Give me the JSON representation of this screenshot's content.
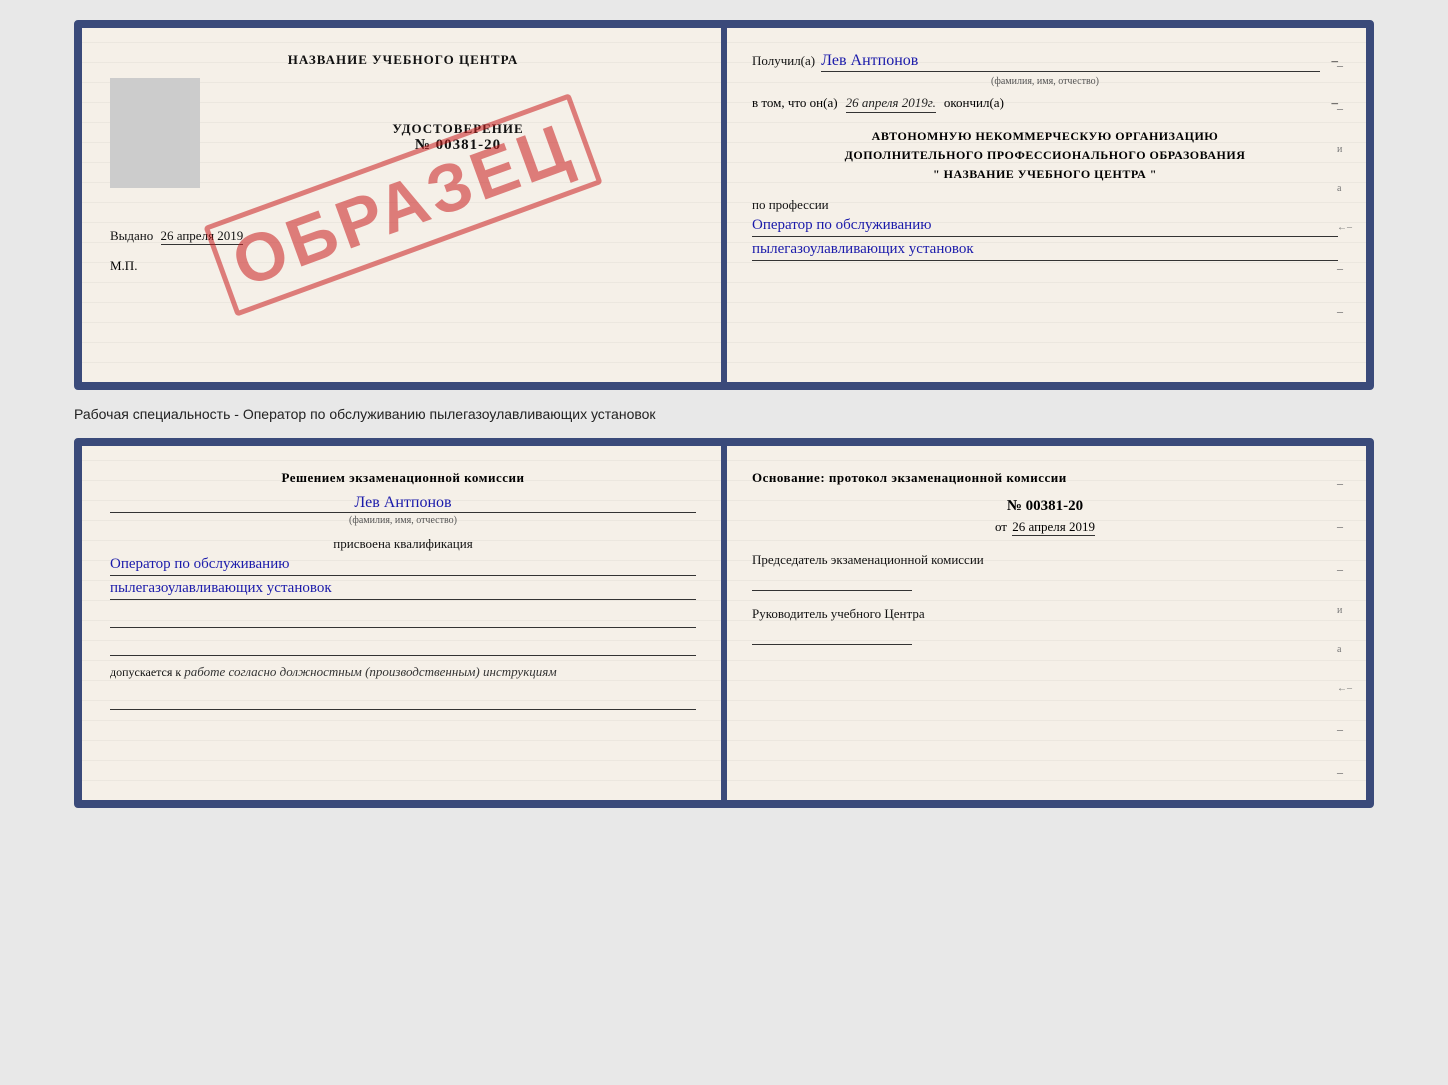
{
  "cert": {
    "left": {
      "training_center": "НАЗВАНИЕ УЧЕБНОГО ЦЕНТРА",
      "udostoverenie_label": "УДОСТОВЕРЕНИЕ",
      "cert_number": "№ 00381-20",
      "issued_label": "Выдано",
      "issued_date": "26 апреля 2019",
      "mp_label": "М.П.",
      "obrazec": "ОБРАЗЕЦ"
    },
    "right": {
      "received_label": "Получил(а)",
      "person_name": "Лев Антпонов",
      "fio_label": "(фамилия, имя, отчество)",
      "completed_prefix": "в том, что он(а)",
      "completed_date": "26 апреля 2019г.",
      "completed_suffix": "окончил(а)",
      "org_line1": "АВТОНОМНУЮ НЕКОММЕРЧЕСКУЮ ОРГАНИЗАЦИЮ",
      "org_line2": "ДОПОЛНИТЕЛЬНОГО ПРОФЕССИОНАЛЬНОГО ОБРАЗОВАНИЯ",
      "org_line3": "\" НАЗВАНИЕ УЧЕБНОГО ЦЕНТРА \"",
      "profession_label": "по профессии",
      "profession_line1": "Оператор по обслуживанию",
      "profession_line2": "пылегазоулавливающих установок"
    }
  },
  "separator": {
    "text": "Рабочая специальность - Оператор по обслуживанию пылегазоулавливающих установок"
  },
  "qual": {
    "left": {
      "commission_title": "Решением экзаменационной комиссии",
      "person_name": "Лев Антпонов",
      "fio_label": "(фамилия, имя, отчество)",
      "assigned_label": "присвоена квалификация",
      "profession_line1": "Оператор по обслуживанию",
      "profession_line2": "пылегазоулавливающих установок",
      "allowed_prefix": "допускается к",
      "allowed_text": "работе согласно должностным (производственным) инструкциям"
    },
    "right": {
      "basis_title": "Основание: протокол экзаменационной комиссии",
      "protocol_number": "№ 00381-20",
      "protocol_date_prefix": "от",
      "protocol_date": "26 апреля 2019",
      "chairman_label": "Председатель экзаменационной комиссии",
      "director_label": "Руководитель учебного Центра"
    }
  }
}
